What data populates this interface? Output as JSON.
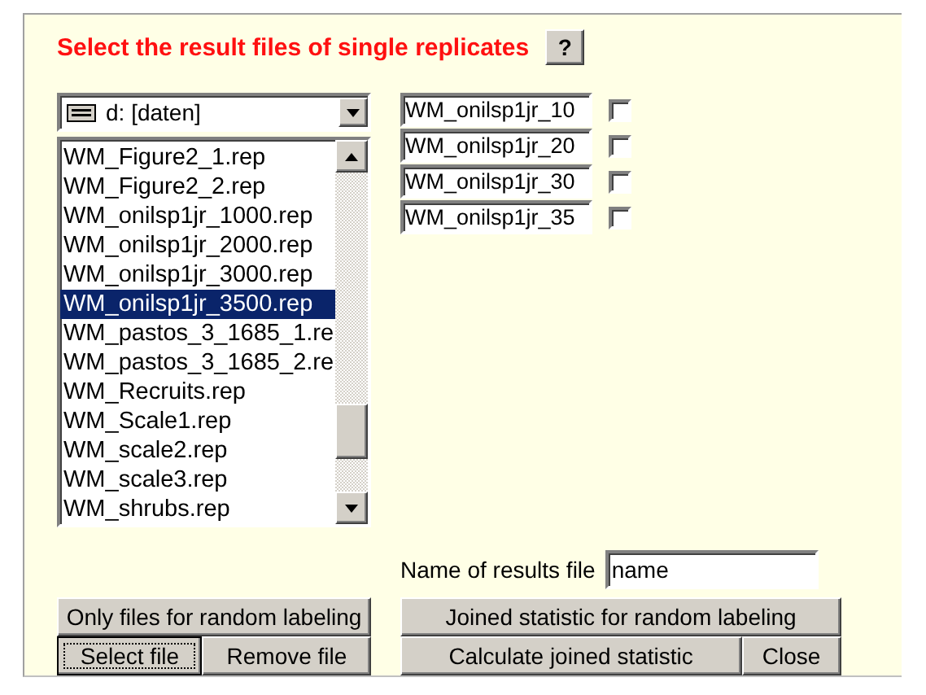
{
  "title": "Select the result files of single replicates",
  "help_button": "?",
  "drive_select": {
    "value": "d: [daten]"
  },
  "file_list": [
    {
      "label": "WM_Figure2_1.rep",
      "selected": false
    },
    {
      "label": "WM_Figure2_2.rep",
      "selected": false
    },
    {
      "label": "WM_onilsp1jr_1000.rep",
      "selected": false
    },
    {
      "label": "WM_onilsp1jr_2000.rep",
      "selected": false
    },
    {
      "label": "WM_onilsp1jr_3000.rep",
      "selected": false
    },
    {
      "label": "WM_onilsp1jr_3500.rep",
      "selected": true
    },
    {
      "label": "WM_pastos_3_1685_1.re",
      "selected": false
    },
    {
      "label": "WM_pastos_3_1685_2.re",
      "selected": false
    },
    {
      "label": "WM_Recruits.rep",
      "selected": false
    },
    {
      "label": "WM_Scale1.rep",
      "selected": false
    },
    {
      "label": "WM_scale2.rep",
      "selected": false
    },
    {
      "label": "WM_scale3.rep",
      "selected": false
    },
    {
      "label": "WM_shrubs.rep",
      "selected": false
    }
  ],
  "selected_files": [
    {
      "value": "WM_onilsp1jr_10",
      "checked": false
    },
    {
      "value": "WM_onilsp1jr_20",
      "checked": false
    },
    {
      "value": "WM_onilsp1jr_30",
      "checked": false
    },
    {
      "value": "WM_onilsp1jr_35",
      "checked": false
    }
  ],
  "results_file": {
    "label": "Name of results file",
    "value": "name"
  },
  "left_buttons": {
    "top": {
      "label": "Only files for random labeling",
      "focused": false
    },
    "bottom": [
      {
        "label": "Select file",
        "focused": true
      },
      {
        "label": "Remove file",
        "focused": false
      }
    ]
  },
  "right_buttons": {
    "top": {
      "label": "Joined statistic for random labeling",
      "focused": false
    },
    "bottom": [
      {
        "label": "Calculate joined statistic",
        "focused": false
      },
      {
        "label": "Close",
        "focused": false
      }
    ]
  }
}
